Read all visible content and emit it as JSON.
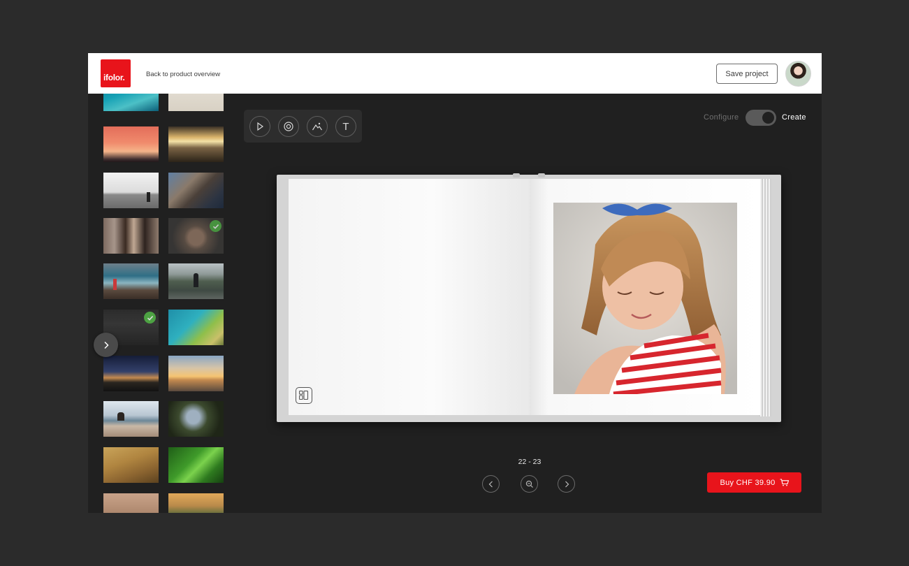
{
  "header": {
    "logo_text": "ifolor.",
    "back_link": "Back to product overview",
    "save_label": "Save project",
    "avatar_icon": "user-avatar"
  },
  "sidebar": {
    "thumbnails": [
      {
        "name": "ocean-aerial",
        "selected": false
      },
      {
        "name": "sand-beige",
        "selected": false
      },
      {
        "name": "pink-sunset",
        "selected": false
      },
      {
        "name": "beach-sunset",
        "selected": false
      },
      {
        "name": "lighthouse-sea",
        "selected": false
      },
      {
        "name": "cliff-coast",
        "selected": false
      },
      {
        "name": "street-people",
        "selected": false
      },
      {
        "name": "girl-portrait",
        "selected": true
      },
      {
        "name": "rocky-shore-girl",
        "selected": false
      },
      {
        "name": "man-road-forest",
        "selected": false
      },
      {
        "name": "dark-hills",
        "selected": true
      },
      {
        "name": "turquoise-bay",
        "selected": false
      },
      {
        "name": "night-sunset-hills",
        "selected": false
      },
      {
        "name": "sea-horizon-sunset",
        "selected": false
      },
      {
        "name": "rock-beach",
        "selected": false
      },
      {
        "name": "tree-canopy",
        "selected": false
      },
      {
        "name": "footprints-sand",
        "selected": false
      },
      {
        "name": "green-leaf",
        "selected": false
      },
      {
        "name": "hands-closeup",
        "selected": false
      },
      {
        "name": "coast-sunset",
        "selected": false
      }
    ],
    "expand_icon": "chevron-right-icon"
  },
  "toolbar": {
    "tools": [
      "play-icon",
      "target-icon",
      "landscape-icon",
      "text-icon"
    ],
    "text_glyph": "T"
  },
  "mode_toggle": {
    "configure_label": "Configure",
    "create_label": "Create",
    "active": "Create"
  },
  "book": {
    "layout_icon": "layout-icon"
  },
  "pager": {
    "page_range": "22 - 23"
  },
  "buy": {
    "label": "Buy CHF 39.90",
    "icon": "cart-icon"
  },
  "colors": {
    "brand_red": "#e8141b",
    "check_green": "#55b94a",
    "dark_bg": "#202020"
  }
}
